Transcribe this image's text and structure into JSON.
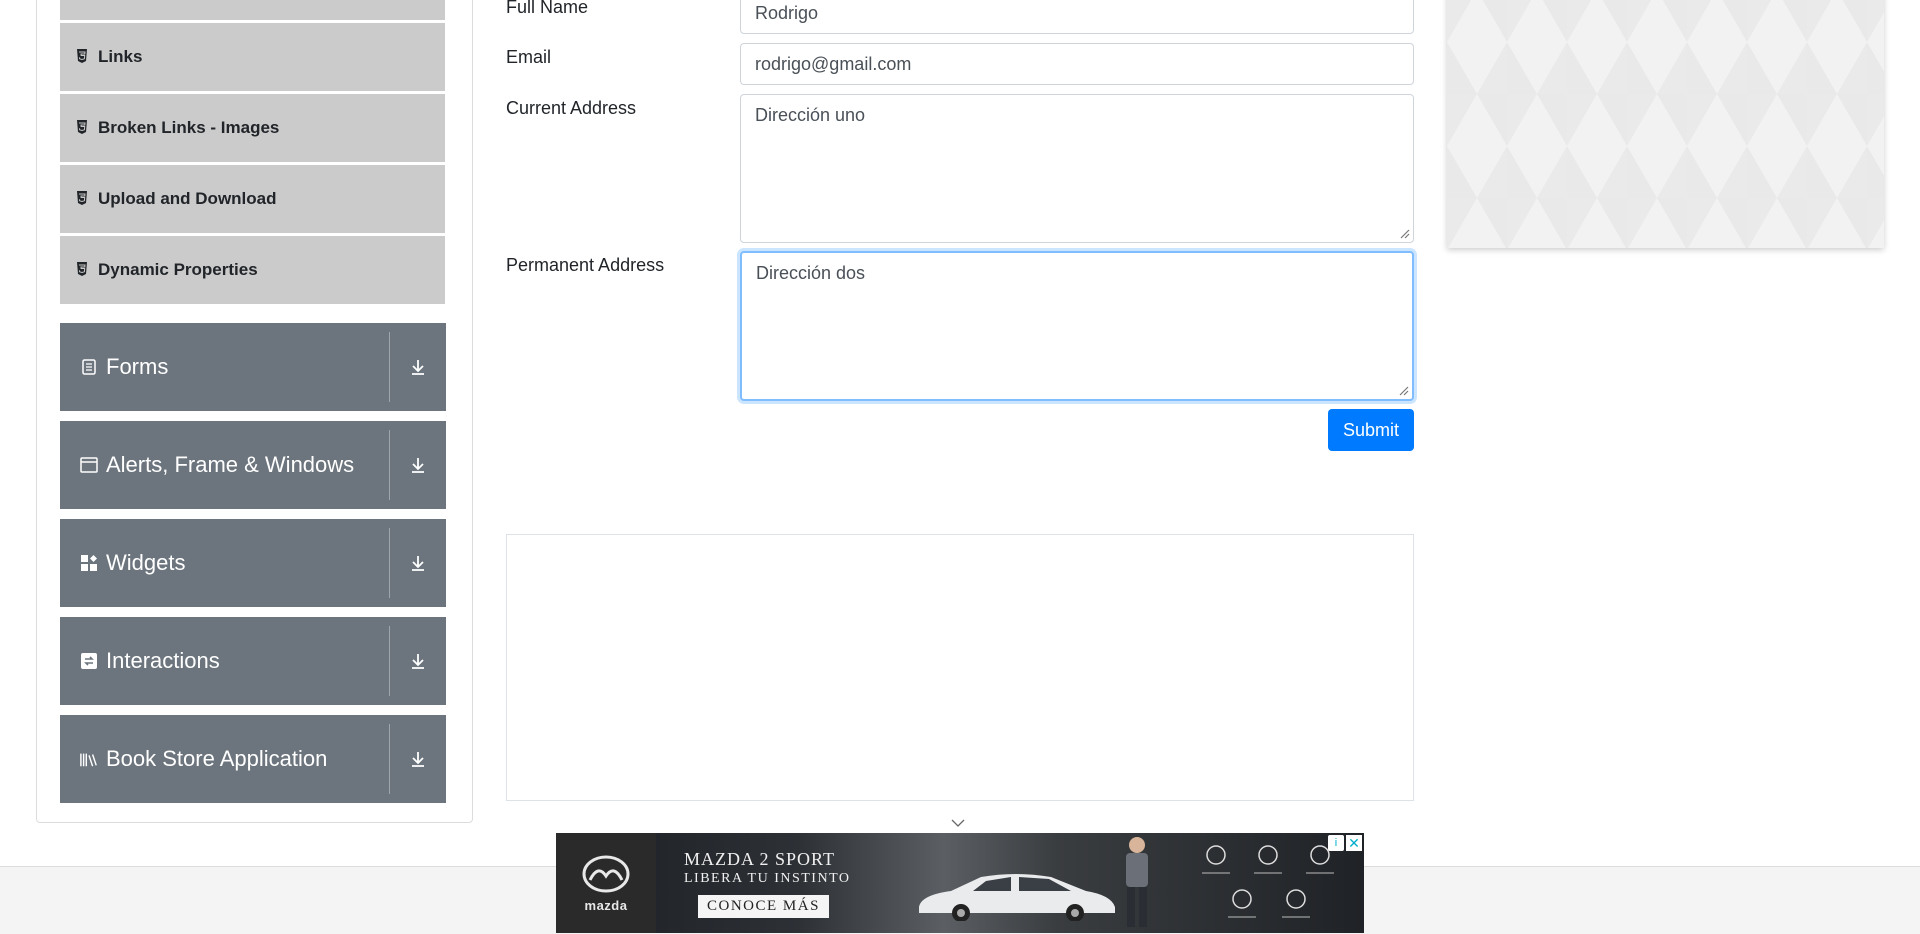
{
  "sidebar": {
    "elements_items": [
      {
        "label": "Links",
        "icon": "html5-icon"
      },
      {
        "label": "Broken Links - Images",
        "icon": "html5-icon"
      },
      {
        "label": "Upload and Download",
        "icon": "html5-icon"
      },
      {
        "label": "Dynamic Properties",
        "icon": "html5-icon"
      }
    ],
    "groups": [
      {
        "label": "Forms",
        "icon": "document-icon"
      },
      {
        "label": "Alerts, Frame & Windows",
        "icon": "window-icon"
      },
      {
        "label": "Widgets",
        "icon": "widgets-icon"
      },
      {
        "label": "Interactions",
        "icon": "swap-icon"
      },
      {
        "label": "Book Store Application",
        "icon": "books-icon"
      }
    ]
  },
  "form": {
    "full_name": {
      "label": "Full Name",
      "value": "Rodrigo"
    },
    "email": {
      "label": "Email",
      "value": "rodrigo@gmail.com"
    },
    "current_address": {
      "label": "Current Address",
      "value": "Dirección uno"
    },
    "permanent_address": {
      "label": "Permanent Address",
      "value": "Dirección dos"
    },
    "submit_label": "Submit"
  },
  "ad": {
    "brand": "mazda",
    "headline": "MAZDA 2 SPORT",
    "tagline": "LIBERA TU INSTINTO",
    "cta": "CONOCE MÁS"
  },
  "colors": {
    "accent": "#007bff",
    "group_bg": "#6c757d",
    "subitem_bg": "#cbcbcb"
  }
}
